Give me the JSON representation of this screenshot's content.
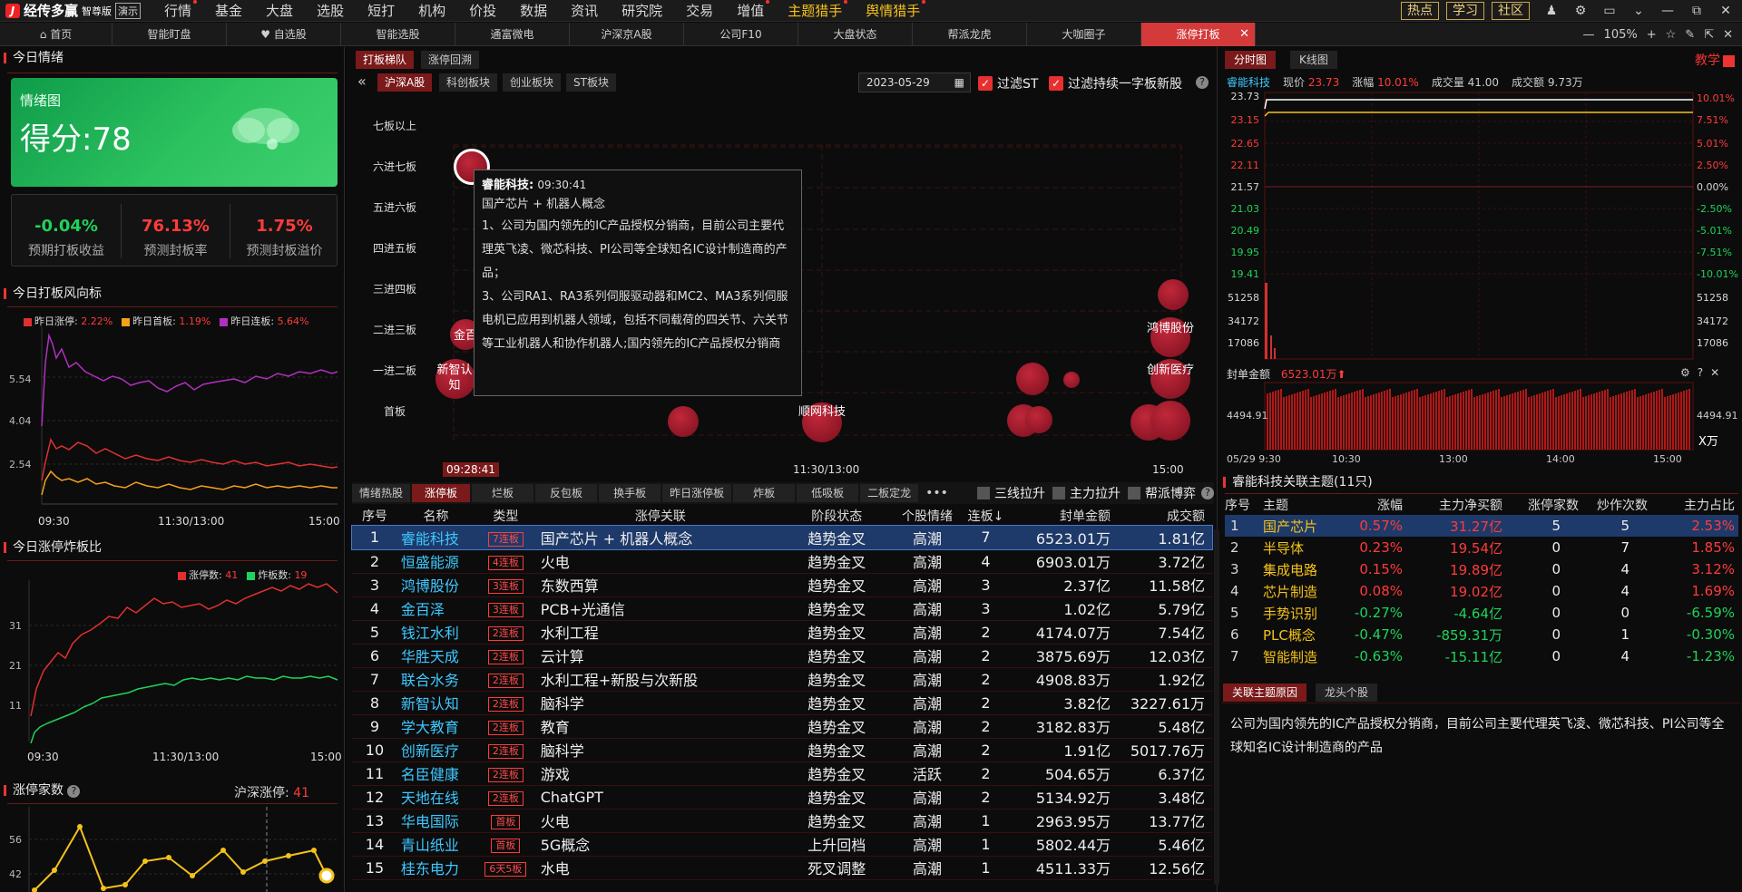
{
  "app": {
    "name": "经传多赢",
    "edition": "智尊版",
    "demo": "演示"
  },
  "menu": [
    {
      "label": "行情",
      "dot": true
    },
    {
      "label": "基金"
    },
    {
      "label": "大盘"
    },
    {
      "label": "选股"
    },
    {
      "label": "短打"
    },
    {
      "label": "机构"
    },
    {
      "label": "价投"
    },
    {
      "label": "数据"
    },
    {
      "label": "资讯"
    },
    {
      "label": "研究院"
    },
    {
      "label": "交易"
    },
    {
      "label": "增值",
      "dot": true
    },
    {
      "label": "主题猎手",
      "dot": true,
      "hl": true
    },
    {
      "label": "舆情猎手",
      "dot": true,
      "hl": true
    }
  ],
  "top_right": {
    "hot": "热点",
    "learn": "学习",
    "community": "社区"
  },
  "tabs": [
    "首页",
    "智能盯盘",
    "自选股",
    "智能选股",
    "通富微电",
    "沪深京A股",
    "公司F10",
    "大盘状态",
    "帮派龙虎",
    "大咖圈子",
    "涨停打板"
  ],
  "zoom": "105%",
  "left": {
    "today_mood": "今日情绪",
    "mood_chart_label": "情绪图",
    "score": "得分:78",
    "stats": [
      {
        "value": "-0.04%",
        "label": "预期打板收益",
        "color": "green"
      },
      {
        "value": "76.13%",
        "label": "预测封板率",
        "color": "red"
      },
      {
        "value": "1.75%",
        "label": "预测封板溢价",
        "color": "red"
      }
    ],
    "wind_title": "今日打板风向标",
    "wind_legend": [
      {
        "name": "昨日涨停:",
        "value": "2.22%",
        "color": "#e03030"
      },
      {
        "name": "昨日首板:",
        "value": "1.19%",
        "color": "#f4a21a"
      },
      {
        "name": "昨日连板:",
        "value": "5.64%",
        "color": "#b030c0"
      }
    ],
    "wind_y": [
      "5.54",
      "4.04",
      "2.54"
    ],
    "wind_x": [
      "09:30",
      "11:30/13:00",
      "15:00"
    ],
    "ratio_title": "今日涨停炸板比",
    "ratio_legend": [
      {
        "name": "涨停数:",
        "value": "41",
        "color": "#e03030"
      },
      {
        "name": "炸板数:",
        "value": "19",
        "color": "#1fd35a"
      }
    ],
    "ratio_y": [
      "31",
      "21",
      "11"
    ],
    "ratio_x": [
      "09:30",
      "11:30/13:00",
      "15:00"
    ],
    "count_title": "涨停家数",
    "count_market": "沪深涨停:",
    "count_value": "41",
    "count_y": [
      "56",
      "42"
    ]
  },
  "middle": {
    "tabs": [
      "打板梯队",
      "涨停回溯"
    ],
    "markets": [
      "沪深A股",
      "科创板块",
      "创业板块",
      "ST板块"
    ],
    "date": "2023-05-29",
    "filter1": "过滤ST",
    "filter2": "过滤持续一字板新股",
    "levels": [
      "七板以上",
      "六进七板",
      "五进六板",
      "四进五板",
      "三进四板",
      "二进三板",
      "一进二板",
      "首板"
    ],
    "x_labels": [
      "09:28:41",
      "11:30/13:00",
      "15:00"
    ],
    "bubble_labels": [
      "金百",
      "新智认知",
      "顺网科技",
      "鸿博股份",
      "创新医疗"
    ],
    "tooltip": {
      "name": "睿能科技:",
      "time": "09:30:41",
      "concept": "国产芯片 + 机器人概念",
      "p1": "1、公司为国内领先的IC产品授权分销商，目前公司主要代理英飞凌、微芯科技、PI公司等全球知名IC设计制造商的产品；",
      "p2": "3、公司RA1、RA3系列伺服驱动器和MC2、MA3系列伺服电机已应用到机器人领域，包括不同载荷的四关节、六关节等工业机器人和协作机器人;国内领先的IC产品授权分销商"
    },
    "table_tabs": [
      "情绪热股",
      "涨停板",
      "烂板",
      "反包板",
      "换手板",
      "昨日涨停板",
      "炸板",
      "低吸板",
      "二板定龙"
    ],
    "table_opts": [
      "三线拉升",
      "主力拉升",
      "帮派博弈"
    ],
    "headers": [
      "序号",
      "名称",
      "类型",
      "涨停关联",
      "阶段状态",
      "个股情绪",
      "连板↓",
      "封单金额",
      "成交额"
    ],
    "rows": [
      [
        "1",
        "睿能科技",
        "7连板",
        "国产芯片 + 机器人概念",
        "趋势金叉",
        "高潮",
        "7",
        "6523.01万",
        "1.81亿"
      ],
      [
        "2",
        "恒盛能源",
        "4连板",
        "火电",
        "趋势金叉",
        "高潮",
        "4",
        "6903.01万",
        "3.72亿"
      ],
      [
        "3",
        "鸿博股份",
        "3连板",
        "东数西算",
        "趋势金叉",
        "高潮",
        "3",
        "2.37亿",
        "11.58亿"
      ],
      [
        "4",
        "金百泽",
        "3连板",
        "PCB+光通信",
        "趋势金叉",
        "高潮",
        "3",
        "1.02亿",
        "5.79亿"
      ],
      [
        "5",
        "钱江水利",
        "2连板",
        "水利工程",
        "趋势金叉",
        "高潮",
        "2",
        "4174.07万",
        "7.54亿"
      ],
      [
        "6",
        "华胜天成",
        "2连板",
        "云计算",
        "趋势金叉",
        "高潮",
        "2",
        "3875.69万",
        "12.03亿"
      ],
      [
        "7",
        "联合水务",
        "2连板",
        "水利工程+新股与次新股",
        "趋势金叉",
        "高潮",
        "2",
        "4908.83万",
        "1.92亿"
      ],
      [
        "8",
        "新智认知",
        "2连板",
        "脑科学",
        "趋势金叉",
        "高潮",
        "2",
        "3.82亿",
        "3227.61万"
      ],
      [
        "9",
        "学大教育",
        "2连板",
        "教育",
        "趋势金叉",
        "高潮",
        "2",
        "3182.83万",
        "5.48亿"
      ],
      [
        "10",
        "创新医疗",
        "2连板",
        "脑科学",
        "趋势金叉",
        "高潮",
        "2",
        "1.91亿",
        "5017.76万"
      ],
      [
        "11",
        "名臣健康",
        "2连板",
        "游戏",
        "趋势金叉",
        "活跃",
        "2",
        "504.65万",
        "6.37亿"
      ],
      [
        "12",
        "天地在线",
        "2连板",
        "ChatGPT",
        "趋势金叉",
        "高潮",
        "2",
        "5134.92万",
        "3.48亿"
      ],
      [
        "13",
        "华电国际",
        "首板",
        "火电",
        "趋势金叉",
        "高潮",
        "1",
        "2963.95万",
        "13.77亿"
      ],
      [
        "14",
        "青山纸业",
        "首板",
        "5G概念",
        "上升回档",
        "高潮",
        "1",
        "5802.44万",
        "5.46亿"
      ],
      [
        "15",
        "桂东电力",
        "6天5板",
        "水电",
        "死叉调整",
        "高潮",
        "1",
        "4511.33万",
        "12.56亿"
      ]
    ]
  },
  "right": {
    "tabs": [
      "分时图",
      "K线图"
    ],
    "teach": "教学",
    "stock": "睿能科技",
    "price_label": "现价",
    "price": "23.73",
    "chg_label": "涨幅",
    "chg": "10.01%",
    "vol_label": "成交量",
    "vol": "41.00",
    "amt_label": "成交额",
    "amt": "9.73万",
    "y_left": [
      "23.73",
      "23.15",
      "22.65",
      "22.11",
      "21.57",
      "21.03",
      "20.49",
      "19.95",
      "19.41",
      "51258",
      "34172",
      "17086"
    ],
    "y_right": [
      "10.01%",
      "7.51%",
      "5.01%",
      "2.50%",
      "0.00%",
      "-2.50%",
      "-5.01%",
      "-7.51%",
      "-10.01%",
      "51258",
      "34172",
      "17086"
    ],
    "seal_label": "封单金额",
    "seal_value": "6523.01万",
    "seal_y": "4494.91",
    "seal_unit": "X万",
    "x_labels": [
      "05/29 9:30",
      "10:30",
      "13:00",
      "14:00",
      "15:00"
    ],
    "theme_title": "睿能科技关联主题(11只)",
    "theme_headers": [
      "序号",
      "主题",
      "涨幅",
      "主力净买额",
      "涨停家数",
      "炒作次数",
      "主力占比"
    ],
    "themes": [
      [
        "1",
        "国产芯片",
        "0.57%",
        "31.27亿",
        "5",
        "5",
        "2.53%"
      ],
      [
        "2",
        "半导体",
        "0.23%",
        "19.54亿",
        "0",
        "7",
        "1.85%"
      ],
      [
        "3",
        "集成电路",
        "0.15%",
        "19.89亿",
        "0",
        "4",
        "3.12%"
      ],
      [
        "4",
        "芯片制造",
        "0.08%",
        "19.02亿",
        "0",
        "4",
        "1.69%"
      ],
      [
        "5",
        "手势识别",
        "-0.27%",
        "-4.64亿",
        "0",
        "0",
        "-6.59%"
      ],
      [
        "6",
        "PLC概念",
        "-0.47%",
        "-859.31万",
        "0",
        "1",
        "-0.30%"
      ],
      [
        "7",
        "智能制造",
        "-0.63%",
        "-15.11亿",
        "0",
        "4",
        "-1.23%"
      ]
    ],
    "reason_tabs": [
      "关联主题原因",
      "龙头个股"
    ],
    "reason": "公司为国内领先的IC产品授权分销商，目前公司主要代理英飞凌、微芯科技、PI公司等全球知名IC设计制造商的产品"
  }
}
